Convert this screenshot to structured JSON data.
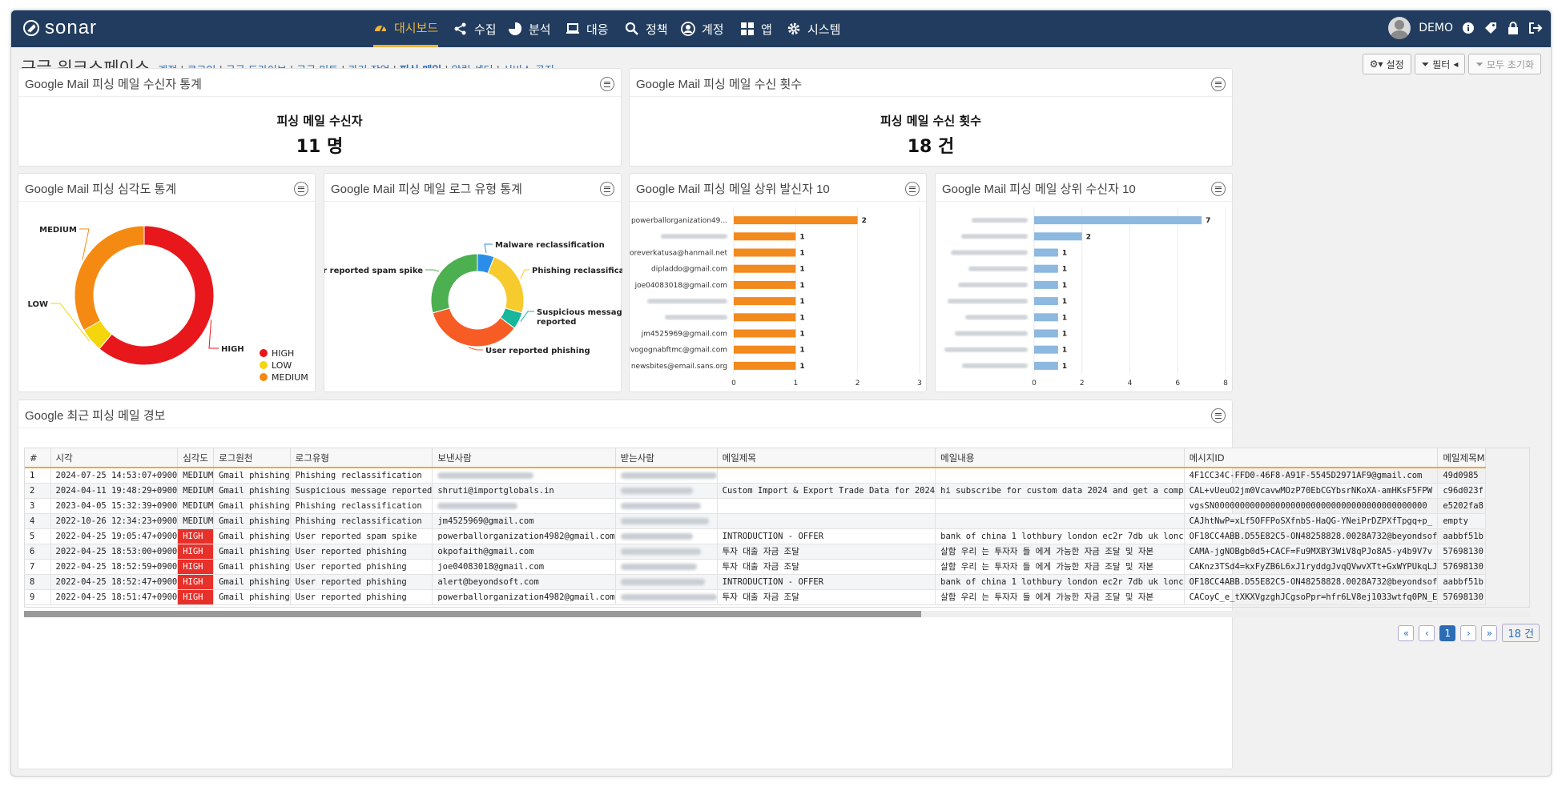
{
  "brand": "sonar",
  "nav": [
    {
      "label": "대시보드",
      "icon": "dashboard-icon",
      "active": true
    },
    {
      "label": "수집",
      "icon": "share-icon"
    },
    {
      "label": "분석",
      "icon": "pie-chart-icon"
    },
    {
      "label": "대응",
      "icon": "laptop-icon"
    },
    {
      "label": "정책",
      "icon": "search-icon"
    },
    {
      "label": "계정",
      "icon": "user-circle-icon"
    },
    {
      "label": "앱",
      "icon": "grid-icon"
    },
    {
      "label": "시스템",
      "icon": "gear-icon"
    }
  ],
  "user": {
    "name": "DEMO"
  },
  "page": {
    "title": "구글 워크스페이스",
    "crumbs": [
      "계정",
      "로그인",
      "구글 드라이브",
      "구글 미트",
      "관리 작업",
      "피싱 메일",
      "알림 센터",
      "서비스 공지"
    ],
    "current_crumb": "피싱 메일"
  },
  "toolbar": {
    "settings": "설정",
    "filter": "필터",
    "reset": "모두 초기화"
  },
  "panels": {
    "recipients_stat": {
      "title": "Google Mail 피싱 메일 수신자 통계",
      "label": "피싱 메일 수신자",
      "value": "11 명"
    },
    "count_stat": {
      "title": "Google Mail 피싱 메일 수신 횟수",
      "label": "피싱 메일 수신 횟수",
      "value": "18 건"
    },
    "severity": {
      "title": "Google Mail 피싱 심각도 통계"
    },
    "logtype": {
      "title": "Google Mail 피싱 메일 로그 유형 통계"
    },
    "top_senders": {
      "title": "Google Mail 피싱 메일 상위 발신자 10"
    },
    "top_recipients": {
      "title": "Google Mail 피싱 메일 상위 수신자 10"
    },
    "recent": {
      "title": "Google 최근 피싱 메일 경보"
    }
  },
  "chart_data": [
    {
      "type": "pie",
      "name": "severity",
      "categories": [
        "HIGH",
        "LOW",
        "MEDIUM"
      ],
      "values": [
        11,
        1,
        6
      ],
      "colors": [
        "#e8171b",
        "#f5d50c",
        "#f58a12"
      ],
      "legend": "bottom-right"
    },
    {
      "type": "pie",
      "name": "logtype",
      "categories": [
        "Malware reclassification",
        "Phishing reclassification",
        "Suspicious message reported",
        "User reported phishing",
        "User reported spam spike"
      ],
      "values": [
        1,
        4,
        1,
        6,
        5
      ],
      "colors": [
        "#2a8de8",
        "#f7cb2e",
        "#16b79c",
        "#f85c25",
        "#4caf50"
      ]
    },
    {
      "type": "bar",
      "name": "top_senders",
      "orientation": "horizontal",
      "categories": [
        "powerballorganization49...",
        "",
        "foreverkatusa@hanmail.net",
        "dipladdo@gmail.com",
        "joe04083018@gmail.com",
        "",
        "",
        "jm4525969@gmail.com",
        "lvogognabftmc@gmail.com",
        "newsbites@email.sans.org"
      ],
      "values": [
        2,
        1,
        1,
        1,
        1,
        1,
        1,
        1,
        1,
        1
      ],
      "xlim": [
        0,
        3
      ],
      "xticks": [
        0,
        1,
        2,
        3
      ],
      "color": "#f28a1e"
    },
    {
      "type": "bar",
      "name": "top_recipients",
      "orientation": "horizontal",
      "categories": [
        "",
        "",
        "",
        "",
        "",
        "",
        "",
        "",
        "",
        ""
      ],
      "values": [
        7,
        2,
        1,
        1,
        1,
        1,
        1,
        1,
        1,
        1
      ],
      "xlim": [
        0,
        8
      ],
      "xticks": [
        0,
        2,
        4,
        6,
        8
      ],
      "color": "#8db8e0"
    }
  ],
  "table": {
    "columns": [
      "#",
      "시각",
      "심각도",
      "로그원천",
      "로그유형",
      "보낸사람",
      "받는사람",
      "메일제목",
      "메일내용",
      "메시지ID",
      "메일제목M"
    ],
    "rows": [
      [
        "1",
        "2024-07-25 14:53:07+0900",
        "MEDIUM",
        "Gmail phishing",
        "Phishing reclassification",
        "",
        "",
        "",
        "",
        "4F1CC34C-FFD0-46F8-A91F-5545D2971AF9@gmail.com",
        "49d0985"
      ],
      [
        "2",
        "2024-04-11 19:48:29+0900",
        "MEDIUM",
        "Gmail phishing",
        "Suspicious message reported",
        "shruti@importglobals.in",
        "",
        "Custom Import & Export Trade Data for 2024",
        "hi subscribe for custom data 2024 and get a comp",
        "CAL+vUeuO2jm0VcavwMOzP70EbCGYbsrNKoXA-amHKsF5FPW",
        "c96d023f"
      ],
      [
        "3",
        "2023-04-05 15:32:39+0900",
        "MEDIUM",
        "Gmail phishing",
        "Phishing reclassification",
        "",
        "",
        "",
        "",
        "vgsSN000000000000000000000000000000000000000000",
        "e5202fa8"
      ],
      [
        "4",
        "2022-10-26 12:34:23+0900",
        "MEDIUM",
        "Gmail phishing",
        "Phishing reclassification",
        "jm4525969@gmail.com",
        "",
        "",
        "",
        "CAJhtNwP=xLf5OFFPoSXfnbS-HaQG-YNeiPrDZPXfTpgq+p_",
        "empty"
      ],
      [
        "5",
        "2022-04-25 19:05:47+0900",
        "HIGH",
        "Gmail phishing",
        "User reported spam spike",
        "powerballorganization4982@gmail.com",
        "",
        "INTRODUCTION - OFFER",
        "bank of china 1 lothbury london ec2r 7db uk lonc",
        "OF18CC4ABB.D55E82C5-ON48258828.0028A732@beyondsof",
        "aabbf51b"
      ],
      [
        "6",
        "2022-04-25 18:53:00+0900",
        "HIGH",
        "Gmail phishing",
        "User reported phishing",
        "okpofaith@gmail.com",
        "",
        "투자 대출 자금 조달",
        "살함 우리 는 투자자 들 에게 가능한 자금 조달 및 자본",
        "CAMA-jgNOBgb0d5+CACF=Fu9MXBY3WiV8qPJo8A5-y4b9V7v",
        "57698130"
      ],
      [
        "7",
        "2022-04-25 18:52:59+0900",
        "HIGH",
        "Gmail phishing",
        "User reported phishing",
        "joe04083018@gmail.com",
        "",
        "투자 대출 자금 조달",
        "살함 우리 는 투자자 들 에게 가능한 자금 조달 및 자본",
        "CAKnz3TSd4=kxFyZB6L6xJ1ryddgJvqQVwvXTt+GxWYPUkqLJ",
        "57698130"
      ],
      [
        "8",
        "2022-04-25 18:52:47+0900",
        "HIGH",
        "Gmail phishing",
        "User reported phishing",
        "alert@beyondsoft.com",
        "",
        "INTRODUCTION - OFFER",
        "bank of china 1 lothbury london ec2r 7db uk lonc",
        "OF18CC4ABB.D55E82C5-ON48258828.0028A732@beyondsof",
        "aabbf51b"
      ],
      [
        "9",
        "2022-04-25 18:51:47+0900",
        "HIGH",
        "Gmail phishing",
        "User reported phishing",
        "powerballorganization4982@gmail.com",
        "",
        "투자 대출 자금 조달",
        "살함 우리 는 투자자 들 에게 가능한 자금 조달 및 자본",
        "CACoyC_e_tXKXVgzghJCgsoPpr=hfr6LV8ej1033wtfq0PN_E",
        "57698130"
      ]
    ]
  },
  "pager": {
    "first": "«",
    "prev": "‹",
    "current": "1",
    "next": "›",
    "last": "»",
    "total": "18 건"
  }
}
